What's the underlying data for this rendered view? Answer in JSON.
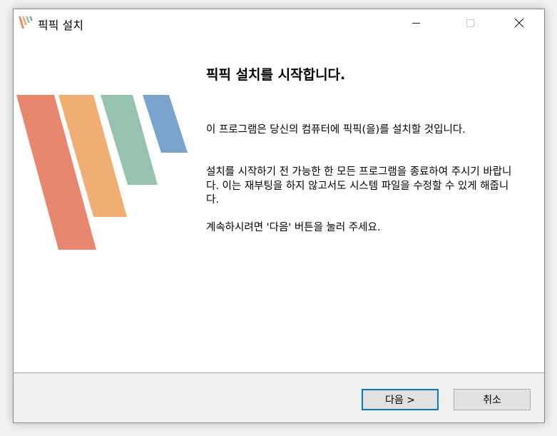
{
  "window": {
    "title": "픽픽 설치",
    "controls": {
      "minimize": "minimize",
      "maximize": "maximize",
      "close": "close"
    }
  },
  "main": {
    "heading": "픽픽 설치를 시작합니다.",
    "paragraphs": [
      "이 프로그램은 당신의 컴퓨터에 픽픽(을)를 설치할 것입니다.",
      "설치를 시작하기 전 가능한 한 모든 프로그램을 종료하여 주시기 바랍니다. 이는 재부팅을 하지 않고서도 시스템 파일을 수정할 수 있게 해줍니다.",
      "계속하시려면 '다음' 버튼을 눌러 주세요."
    ]
  },
  "footer": {
    "next_label": "다음 >",
    "cancel_label": "취소"
  },
  "colors": {
    "stripe_red": "#e8876f",
    "stripe_orange": "#f0ae73",
    "stripe_green": "#98c2b0",
    "stripe_blue": "#7aa4cc",
    "focus_blue": "#0078d7"
  }
}
